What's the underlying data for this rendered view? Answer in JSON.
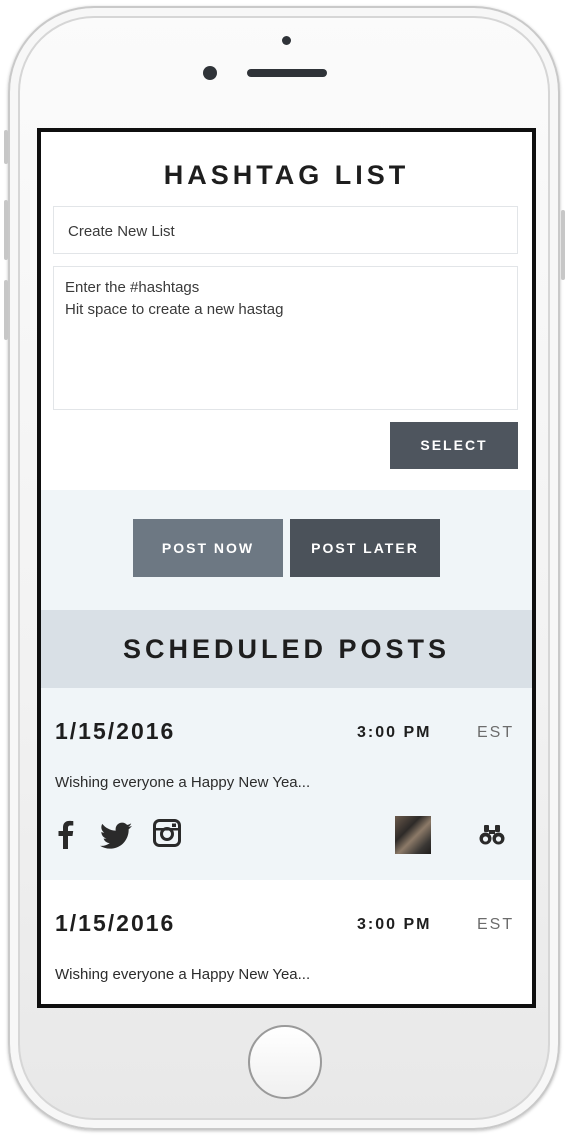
{
  "hashtag_list": {
    "title": "HASHTAG LIST",
    "list_name_input": {
      "value": "Create New List",
      "placeholder": "Create New List"
    },
    "hashtags_input": {
      "line1": "Enter the #hashtags",
      "line2": "Hit space to create a new hastag"
    },
    "select_label": "SELECT"
  },
  "actions": {
    "post_now_label": "POST NOW",
    "post_later_label": "POST LATER"
  },
  "scheduled": {
    "title": "SCHEDULED POSTS",
    "posts": [
      {
        "date": "1/15/2016",
        "time": "3:00 PM",
        "timezone": "EST",
        "message": "Wishing everyone a Happy New Yea...",
        "networks": [
          "facebook-icon",
          "twitter-icon",
          "instagram-icon"
        ],
        "has_image": true,
        "action_icon": "binoculars-icon"
      },
      {
        "date": "1/15/2016",
        "time": "3:00 PM",
        "timezone": "EST",
        "message": "Wishing everyone a Happy New Yea..."
      }
    ]
  },
  "colors": {
    "dark_button": "#4e555e",
    "light_button": "#6d7883",
    "band_background": "#f0f5f8",
    "header_background": "#d9e0e6"
  }
}
